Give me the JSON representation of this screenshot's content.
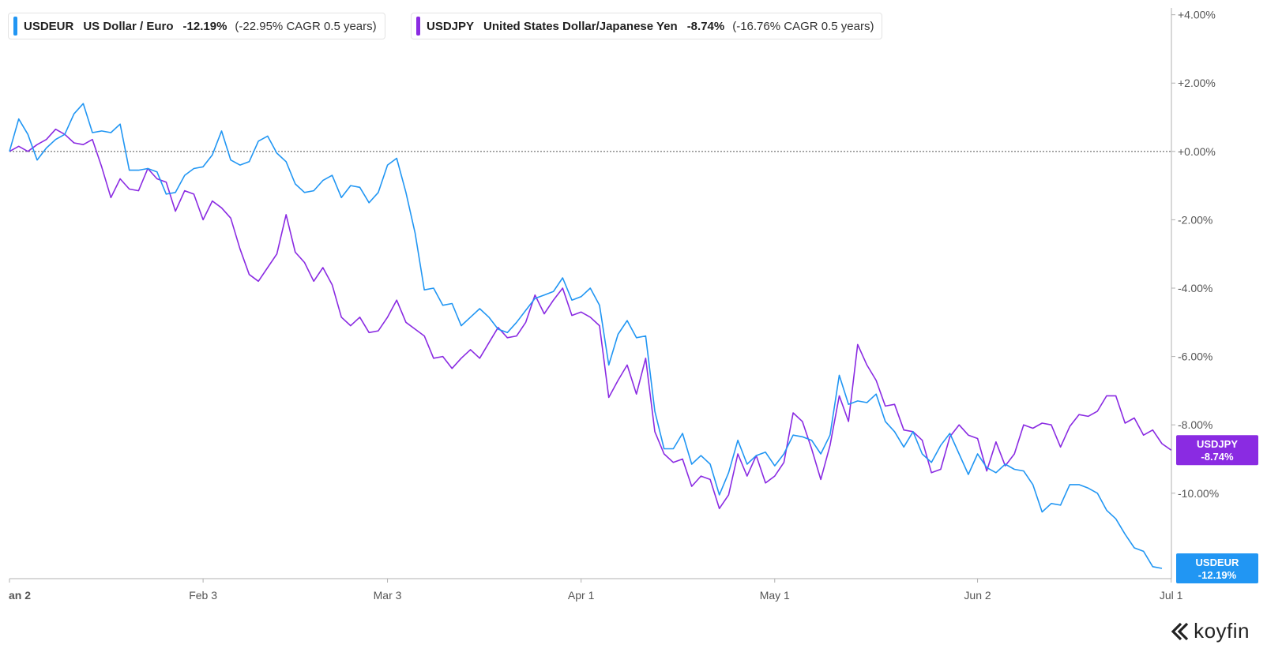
{
  "legend": [
    {
      "ticker": "USDEUR",
      "name": "US Dollar / Euro",
      "change": "-12.19%",
      "cagr": "(-22.95% CAGR 0.5 years)",
      "color": "#2196f3"
    },
    {
      "ticker": "USDJPY",
      "name": "United States Dollar/Japanese Yen",
      "change": "-8.74%",
      "cagr": "(-16.76% CAGR 0.5 years)",
      "color": "#8a2be2"
    }
  ],
  "logo": {
    "text": "koyfin",
    "icon": "koyfin-chevron-logo-icon"
  },
  "chart_data": {
    "type": "line",
    "x_axis": {
      "ticks": [
        "an 2",
        "Feb 3",
        "Mar 3",
        "Apr 1",
        "May 1",
        "Jun 2",
        "Jul 1"
      ],
      "tick_index": [
        0,
        21,
        41,
        62,
        83,
        105,
        126
      ]
    },
    "y_axis": {
      "position": "right",
      "ylim": [
        -12.5,
        4.2
      ],
      "ticks": [
        4,
        2,
        0,
        -2,
        -4,
        -6,
        -8,
        -10
      ],
      "tick_labels": [
        "+4.00%",
        "+2.00%",
        "+0.00%",
        "-2.00%",
        "-4.00%",
        "-6.00%",
        "-8.00%",
        "-10.00%"
      ]
    },
    "reference_line": 0,
    "end_tags": [
      {
        "series": "USDJPY",
        "ticker": "USDJPY",
        "value_label": "-8.74%",
        "color": "#8a2be2"
      },
      {
        "series": "USDEUR",
        "ticker": "USDEUR",
        "value_label": "-12.19%",
        "color": "#2196f3"
      }
    ],
    "series": [
      {
        "name": "USDEUR",
        "color": "#2196f3",
        "values": [
          0,
          0.95,
          0.5,
          -0.25,
          0.1,
          0.35,
          0.5,
          1.1,
          1.4,
          0.55,
          0.6,
          0.55,
          0.8,
          -0.55,
          -0.55,
          -0.5,
          -0.6,
          -1.25,
          -1.2,
          -0.7,
          -0.5,
          -0.45,
          -0.1,
          0.6,
          -0.25,
          -0.4,
          -0.3,
          0.3,
          0.45,
          -0.05,
          -0.3,
          -0.95,
          -1.2,
          -1.15,
          -0.85,
          -0.7,
          -1.35,
          -1.0,
          -1.05,
          -1.5,
          -1.2,
          -0.4,
          -0.2,
          -1.2,
          -2.4,
          -4.05,
          -4.0,
          -4.5,
          -4.45,
          -5.1,
          -4.85,
          -4.6,
          -4.85,
          -5.2,
          -5.3,
          -5.0,
          -4.65,
          -4.3,
          -4.2,
          -4.1,
          -3.7,
          -4.35,
          -4.25,
          -4.0,
          -4.5,
          -6.25,
          -5.35,
          -4.95,
          -5.45,
          -5.4,
          -7.6,
          -8.7,
          -8.7,
          -8.25,
          -9.15,
          -8.9,
          -9.15,
          -10.05,
          -9.4,
          -8.45,
          -9.15,
          -8.9,
          -8.8,
          -9.2,
          -8.85,
          -8.3,
          -8.35,
          -8.45,
          -8.85,
          -8.3,
          -6.55,
          -7.4,
          -7.3,
          -7.35,
          -7.1,
          -7.9,
          -8.2,
          -8.65,
          -8.2,
          -8.85,
          -9.1,
          -8.6,
          -8.25,
          -8.85,
          -9.45,
          -8.85,
          -9.25,
          -9.4,
          -9.15,
          -9.3,
          -9.35,
          -9.75,
          -10.55,
          -10.3,
          -10.35,
          -9.75,
          -9.75,
          -9.85,
          -10.0,
          -10.5,
          -10.75,
          -11.2,
          -11.6,
          -11.7,
          -12.15,
          -12.2
        ]
      },
      {
        "name": "USDJPY",
        "color": "#8a2be2",
        "values": [
          0,
          0.15,
          0.0,
          0.2,
          0.35,
          0.65,
          0.5,
          0.25,
          0.2,
          0.35,
          -0.45,
          -1.35,
          -0.8,
          -1.1,
          -1.15,
          -0.5,
          -0.8,
          -0.9,
          -1.75,
          -1.15,
          -1.25,
          -2.0,
          -1.45,
          -1.65,
          -1.95,
          -2.85,
          -3.6,
          -3.8,
          -3.4,
          -3.0,
          -1.85,
          -2.95,
          -3.25,
          -3.8,
          -3.4,
          -3.9,
          -4.85,
          -5.1,
          -4.85,
          -5.3,
          -5.25,
          -4.85,
          -4.35,
          -5.0,
          -5.2,
          -5.4,
          -6.05,
          -6.0,
          -6.35,
          -6.05,
          -5.8,
          -6.05,
          -5.6,
          -5.15,
          -5.45,
          -5.4,
          -5.0,
          -4.2,
          -4.75,
          -4.35,
          -4.0,
          -4.8,
          -4.7,
          -4.85,
          -5.1,
          -7.2,
          -6.7,
          -6.25,
          -7.1,
          -6.05,
          -8.2,
          -8.85,
          -9.1,
          -9.0,
          -9.8,
          -9.5,
          -9.6,
          -10.45,
          -10.05,
          -8.85,
          -9.5,
          -8.9,
          -9.7,
          -9.5,
          -9.1,
          -7.65,
          -7.9,
          -8.7,
          -9.6,
          -8.6,
          -7.15,
          -7.9,
          -5.65,
          -6.25,
          -6.7,
          -7.45,
          -7.4,
          -8.15,
          -8.2,
          -8.45,
          -9.4,
          -9.3,
          -8.35,
          -8.0,
          -8.3,
          -8.4,
          -9.35,
          -8.5,
          -9.2,
          -8.85,
          -8.0,
          -8.1,
          -7.95,
          -8.0,
          -8.65,
          -8.05,
          -7.7,
          -7.75,
          -7.6,
          -7.15,
          -7.15,
          -7.95,
          -7.8,
          -8.3,
          -8.15,
          -8.55,
          -8.74
        ]
      }
    ]
  }
}
